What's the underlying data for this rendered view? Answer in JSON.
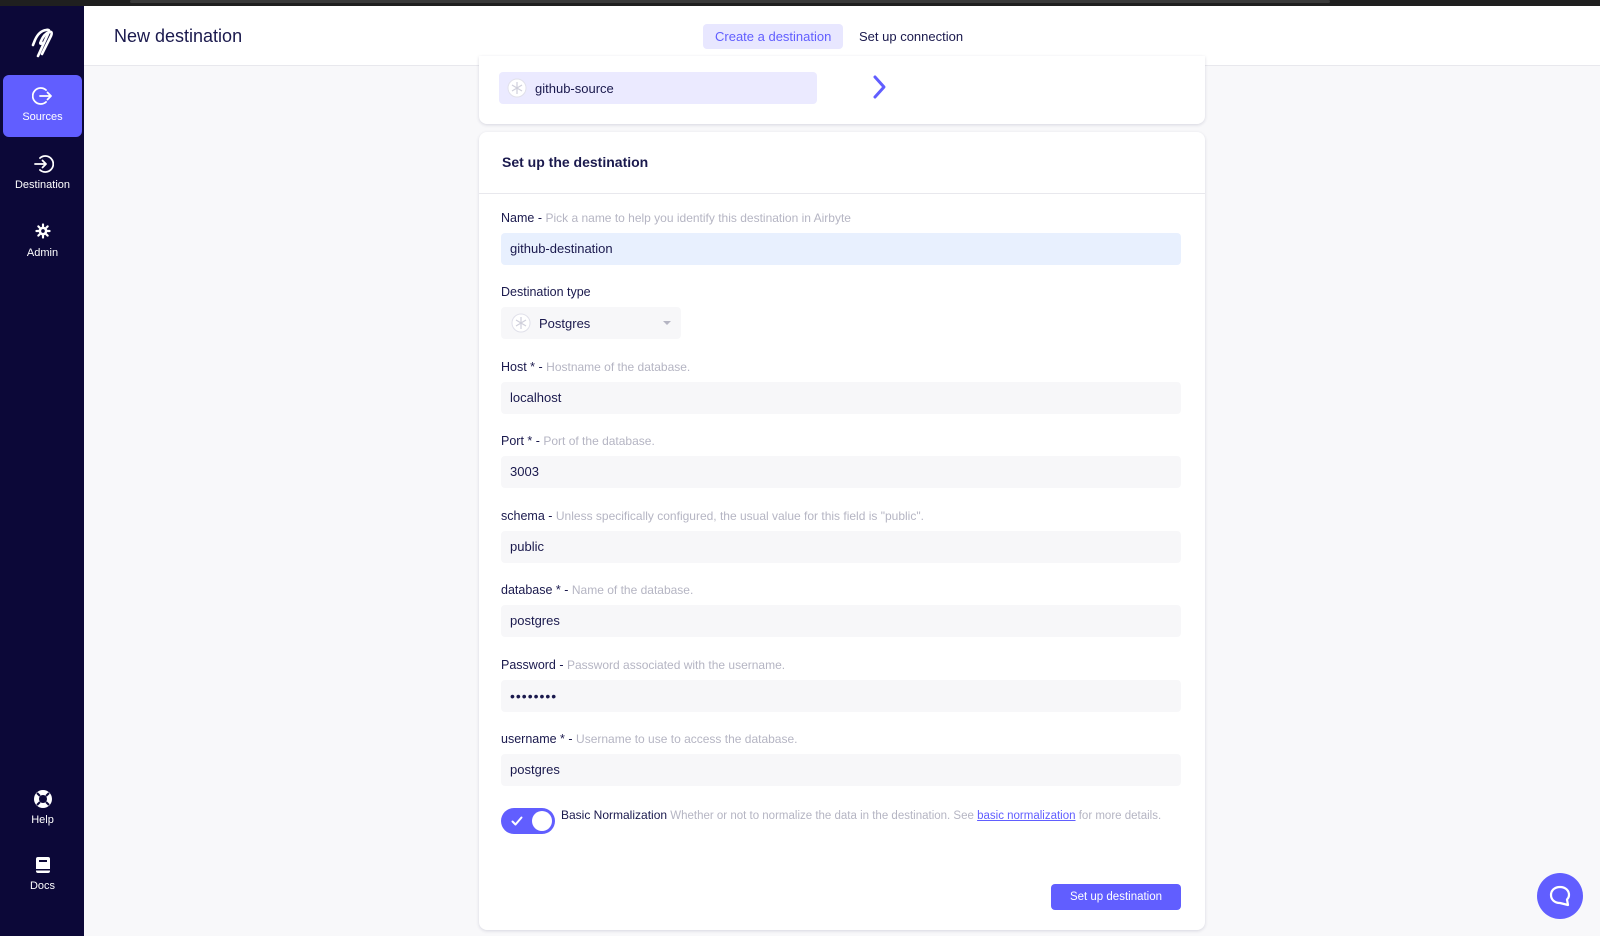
{
  "sidebar": {
    "items": [
      {
        "label": "Sources",
        "icon": "arrow-right-circle-icon",
        "active": true
      },
      {
        "label": "Destination",
        "icon": "login-arrow-icon"
      },
      {
        "label": "Admin",
        "icon": "gear-icon"
      },
      {
        "label": "Help",
        "icon": "lifebuoy-icon"
      },
      {
        "label": "Docs",
        "icon": "book-icon"
      }
    ]
  },
  "header": {
    "title": "New destination",
    "steps": [
      "Create a destination",
      "Set up connection"
    ],
    "active_step": 0
  },
  "source_card": {
    "source_name": "github-source"
  },
  "form": {
    "heading": "Set up the destination",
    "name": {
      "label": "Name - ",
      "hint": "Pick a name to help you identify this destination in Airbyte",
      "value": "github-destination"
    },
    "destination_type": {
      "label": "Destination type",
      "value": "Postgres"
    },
    "host": {
      "label": "Host * - ",
      "hint": "Hostname of the database.",
      "value": "localhost"
    },
    "port": {
      "label": "Port * - ",
      "hint": "Port of the database.",
      "value": "3003"
    },
    "schema": {
      "label": "schema - ",
      "hint": "Unless specifically configured, the usual value for this field is \"public\".",
      "value": "public"
    },
    "database": {
      "label": "database * - ",
      "hint": "Name of the database.",
      "value": "postgres"
    },
    "password": {
      "label": "Password - ",
      "hint": "Password associated with the username.",
      "value": "••••••••"
    },
    "username": {
      "label": "username * - ",
      "hint": "Username to use to access the database.",
      "value": "postgres"
    },
    "normalization": {
      "label": "Basic Normalization",
      "hint_before": " Whether or not to normalize the data in the destination. See ",
      "link": "basic normalization",
      "hint_after": " for more details.",
      "enabled": true
    },
    "submit_label": "Set up destination"
  },
  "colors": {
    "accent": "#615eff",
    "sidebar_bg": "#0c0838",
    "text_dark": "#1a194d",
    "hint": "#b5b5c3"
  }
}
